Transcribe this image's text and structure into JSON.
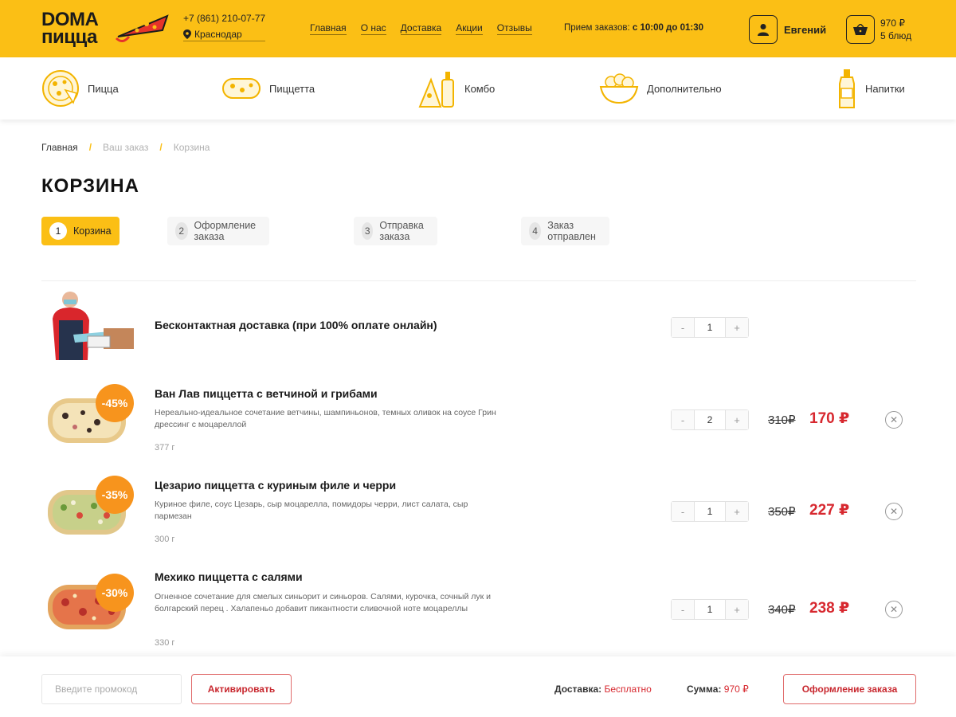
{
  "header": {
    "logo_line1": "DOMA",
    "logo_line2": "пицца",
    "phone": "+7 (861) 210-07-77",
    "city": "Краснодар",
    "nav": [
      "Главная",
      "О нас",
      "Доставка",
      "Акции",
      "Отзывы"
    ],
    "hours_label": "Прием заказов:",
    "hours_value": "с 10:00 до 01:30",
    "user_name": "Евгений",
    "cart_total": "970 ₽",
    "cart_count": "5 блюд",
    "accent_color": "#fbbf15"
  },
  "categories": [
    {
      "label": "Пицца",
      "icon": "pizza-icon"
    },
    {
      "label": "Пиццетта",
      "icon": "pizzetta-icon"
    },
    {
      "label": "Комбо",
      "icon": "combo-icon"
    },
    {
      "label": "Дополнительно",
      "icon": "bowl-icon"
    },
    {
      "label": "Напитки",
      "icon": "bottle-icon"
    }
  ],
  "breadcrumb": [
    "Главная",
    "Ваш заказ",
    "Корзина"
  ],
  "page_title": "КОРЗИНА",
  "steps": [
    {
      "num": "1",
      "label": "Корзина"
    },
    {
      "num": "2",
      "label": "Оформление заказа"
    },
    {
      "num": "3",
      "label": "Отправка заказа"
    },
    {
      "num": "4",
      "label": "Заказ отправлен"
    }
  ],
  "items": [
    {
      "title": "Бесконтактная доставка (при 100% оплате онлайн)",
      "qty": "1"
    },
    {
      "title": "Ван Лав пиццетта с ветчиной и грибами",
      "desc": "Нереально-идеальное сочетание ветчины, шампиньонов, темных оливок на соусе Грин дрессинг с моцареллой",
      "weight": "377 г",
      "discount": "-45%",
      "qty": "2",
      "old_price": "310₽",
      "new_price": "170 ₽"
    },
    {
      "title": "Цезарио пиццетта с куриным филе и черри",
      "desc": "Куриное филе, соус Цезарь, сыр моцарелла, помидоры черри, лист салата, сыр пармезан",
      "weight": "300 г",
      "discount": "-35%",
      "qty": "1",
      "old_price": "350₽",
      "new_price": "227 ₽"
    },
    {
      "title": "Мехико пиццетта с салями",
      "desc": "Огненное сочетание для смелых синьорит и синьоров. Салями, курочка, сочный лук и болгарский перец . Халапеньо добавит пикантности сливочной ноте моцареллы",
      "weight": "330 г",
      "discount": "-30%",
      "qty": "1",
      "old_price": "340₽",
      "new_price": "238 ₽"
    }
  ],
  "footer": {
    "promo_placeholder": "Введите промокод",
    "activate_label": "Активировать",
    "delivery_label": "Доставка:",
    "delivery_value": "Бесплатно",
    "sum_label": "Сумма:",
    "sum_value": "970 ₽",
    "checkout_label": "Оформление заказа"
  },
  "qty_minus": "-",
  "qty_plus": "+"
}
